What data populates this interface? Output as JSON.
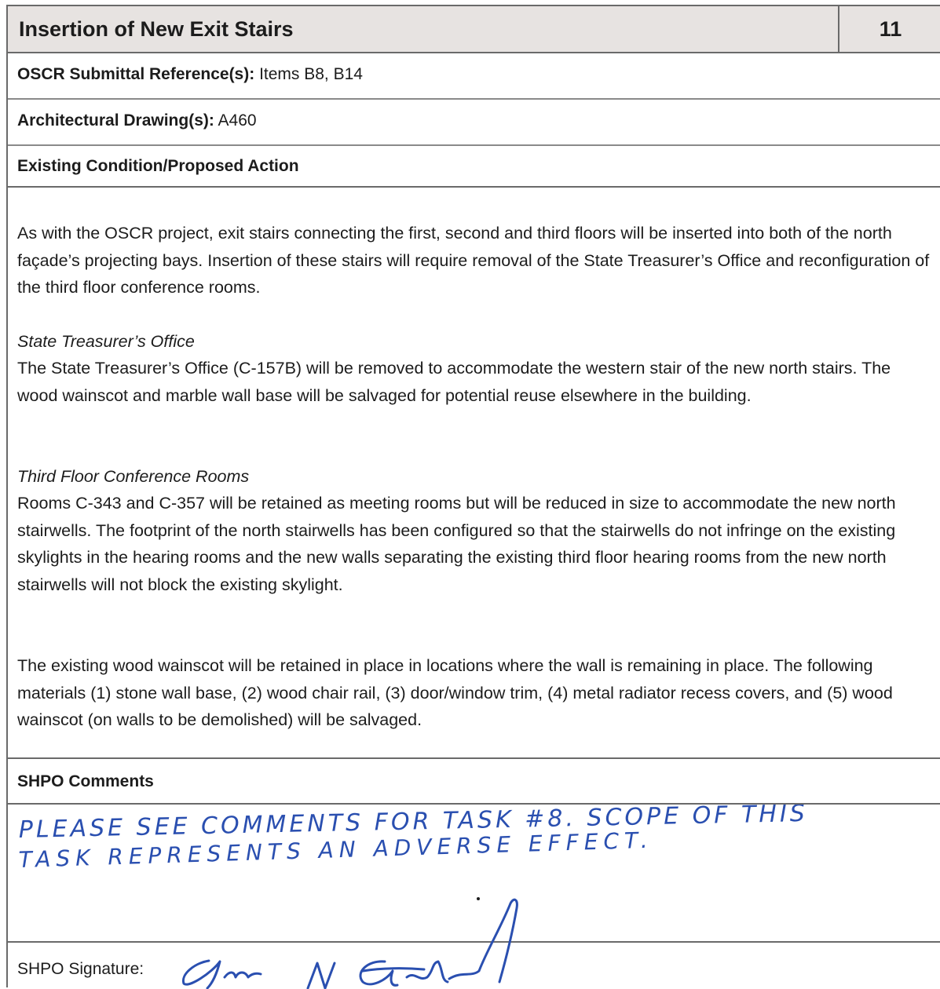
{
  "header": {
    "title": "Insertion of New Exit Stairs",
    "number": "11"
  },
  "oscr_ref": {
    "label": "OSCR Submittal Reference(s):",
    "value": " Items B8, B14"
  },
  "drawings": {
    "label": "Architectural Drawing(s):",
    "value": " A460"
  },
  "section_heading": "Existing Condition/Proposed Action",
  "body": {
    "intro": "As with the OSCR project, exit stairs connecting the first, second and third floors will be inserted into both of the north façade’s projecting bays. Insertion of these stairs will require removal of the State Treasurer’s Office and reconfiguration of the third floor conference rooms.",
    "treasurer_heading": "State Treasurer’s Office",
    "treasurer_text": "The State Treasurer’s Office (C-157B) will be removed to accommodate the western stair of the new north stairs. The wood wainscot and marble wall base will be salvaged for potential reuse elsewhere in the building.",
    "conference_heading": "Third Floor Conference Rooms",
    "conference_text": "Rooms C-343 and C-357 will be retained as meeting rooms but will be reduced in size to accommodate the new north stairwells. The footprint of the north stairwells has been configured so that the stairwells do not infringe on the existing skylights in the hearing rooms and the new walls separating the existing third floor hearing rooms from the new north stairwells will not block the existing skylight.",
    "closing_text": "The existing wood wainscot will be retained in place in locations where the wall is remaining in place. The following materials (1) stone wall base, (2) wood chair rail, (3) door/window trim, (4) metal radiator recess covers, and (5) wood wainscot (on walls to be demolished) will be salvaged."
  },
  "comments": {
    "label": "SHPO Comments",
    "handwritten_line_1": "PLEASE SEE COMMENTS FOR TASK #8. SCOPE OF THIS",
    "handwritten_line_2": "TASK REPRESENTS AN ADVERSE EFFECT."
  },
  "signature": {
    "label": "SHPO Signature:"
  },
  "colors": {
    "header_bg": "#e7e3e1",
    "ink": "#2a4fb0",
    "rule": "#6a6a6a"
  }
}
